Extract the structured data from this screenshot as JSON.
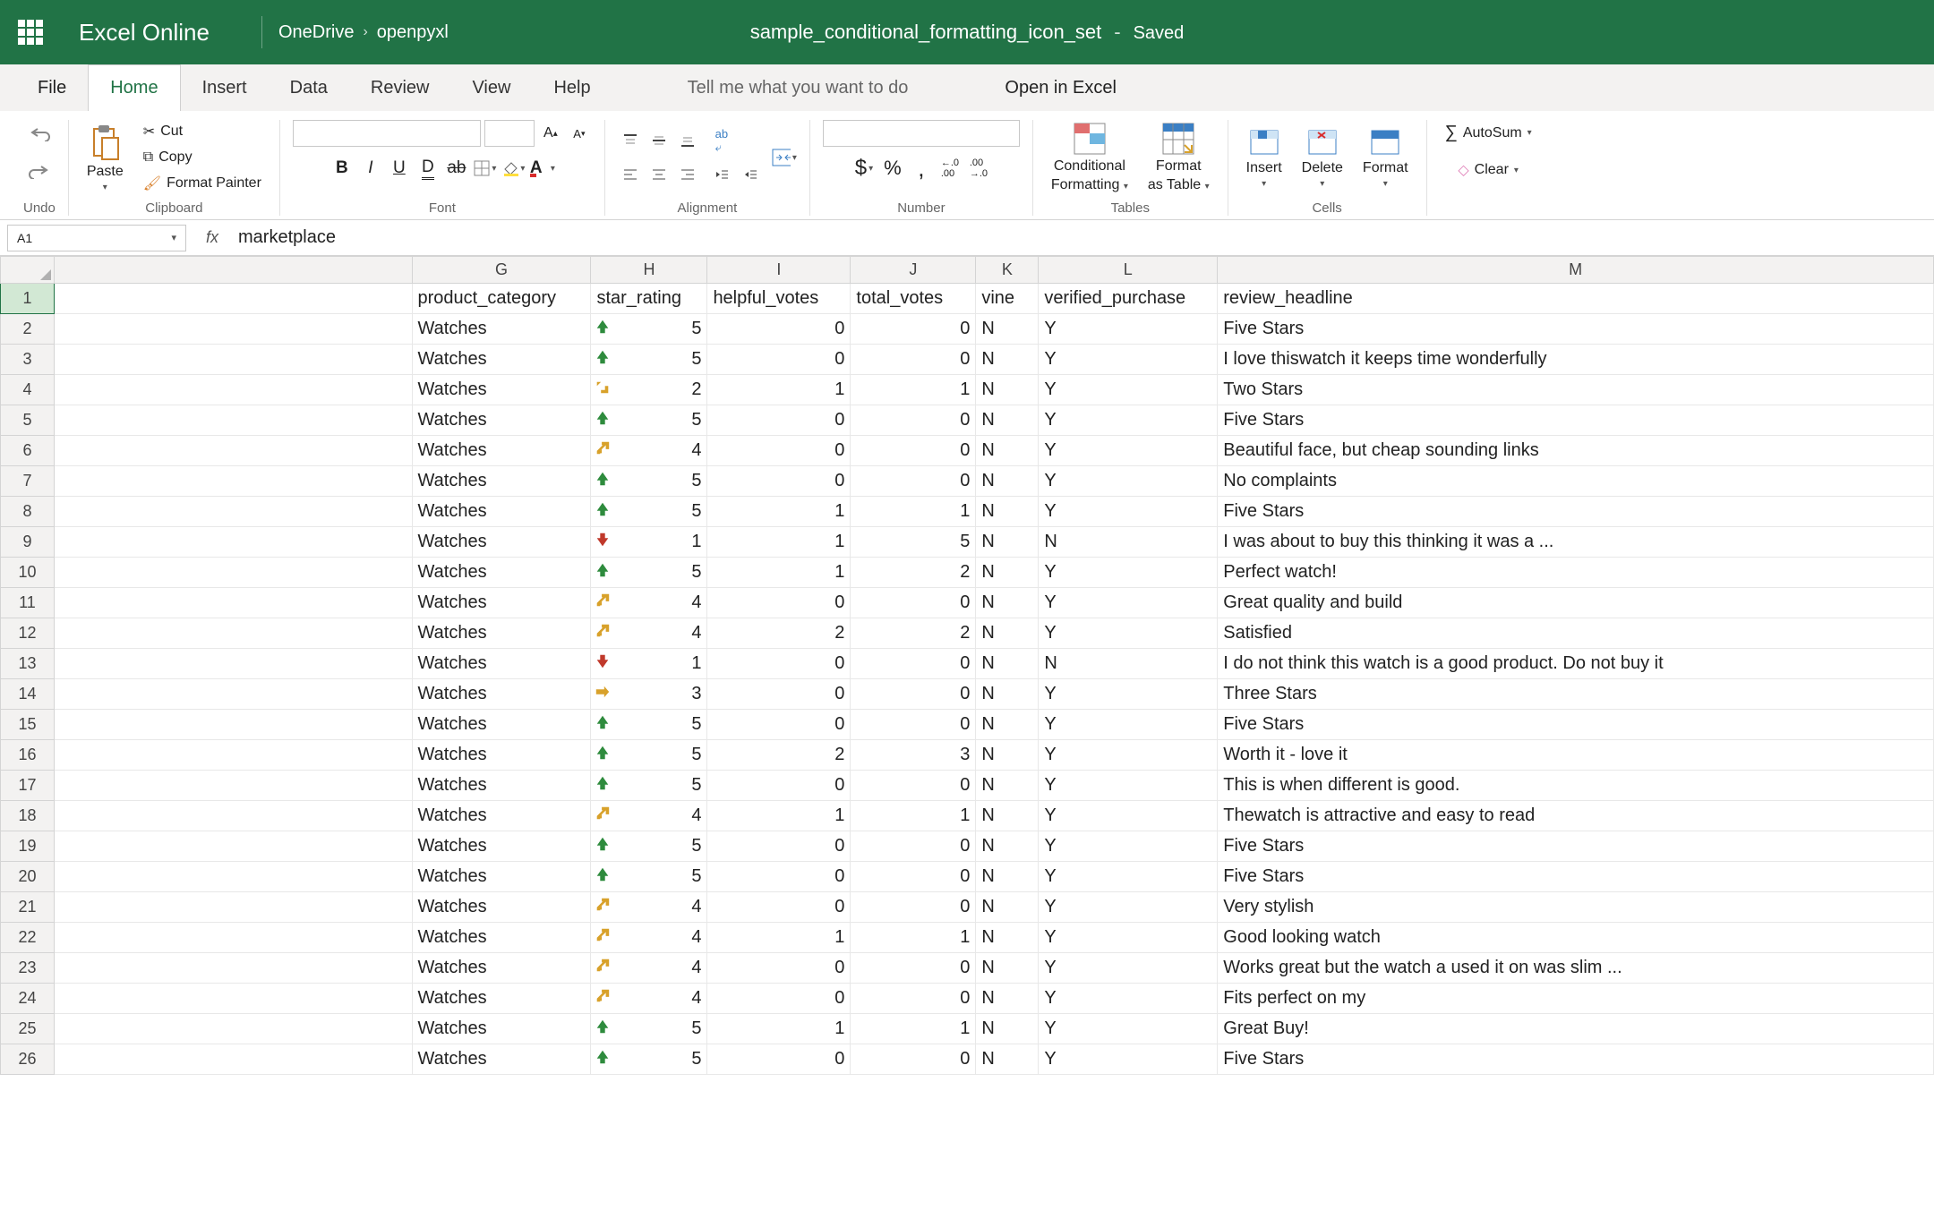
{
  "titlebar": {
    "app_name": "Excel Online",
    "breadcrumb": [
      "OneDrive",
      "openpyxl"
    ],
    "doc_title": "sample_conditional_formatting_icon_set",
    "saved_label": "Saved"
  },
  "ribbon_tabs": {
    "file": "File",
    "home": "Home",
    "insert": "Insert",
    "data": "Data",
    "review": "Review",
    "view": "View",
    "help": "Help",
    "tellme": "Tell me what you want to do",
    "open_in_excel": "Open in Excel"
  },
  "ribbon": {
    "undo_label": "Undo",
    "paste": "Paste",
    "cut": "Cut",
    "copy": "Copy",
    "format_painter": "Format Painter",
    "clipboard_label": "Clipboard",
    "font_label": "Font",
    "alignment_label": "Alignment",
    "number_label": "Number",
    "dollar": "$",
    "percent": "%",
    "comma": ",",
    "dec_inc": ".00",
    "dec_dec": ".00",
    "tables_label": "Tables",
    "cond_fmt": "Conditional",
    "cond_fmt2": "Formatting",
    "fmt_table": "Format",
    "fmt_table2": "as Table",
    "cells_label": "Cells",
    "insert_btn": "Insert",
    "delete_btn": "Delete",
    "format_btn": "Format",
    "autosum": "AutoSum",
    "clear": "Clear"
  },
  "formula_bar": {
    "namebox": "A1",
    "fx": "fx",
    "value": "marketplace"
  },
  "columns": [
    "G",
    "H",
    "I",
    "J",
    "K",
    "L",
    "M"
  ],
  "headers": {
    "G": "product_category",
    "H": "star_rating",
    "I": "helpful_votes",
    "J": "total_votes",
    "K": "vine",
    "L": "verified_purchase",
    "M": "review_headline"
  },
  "rows": [
    {
      "n": 2,
      "G": "Watches",
      "H": 5,
      "icon": "up",
      "I": 0,
      "J": 0,
      "K": "N",
      "L": "Y",
      "M": "Five Stars"
    },
    {
      "n": 3,
      "G": "Watches",
      "H": 5,
      "icon": "up",
      "I": 0,
      "J": 0,
      "K": "N",
      "L": "Y",
      "M": "I love thiswatch it keeps time wonderfully"
    },
    {
      "n": 4,
      "G": "Watches",
      "H": 2,
      "icon": "diag-down",
      "I": 1,
      "J": 1,
      "K": "N",
      "L": "Y",
      "M": "Two Stars"
    },
    {
      "n": 5,
      "G": "Watches",
      "H": 5,
      "icon": "up",
      "I": 0,
      "J": 0,
      "K": "N",
      "L": "Y",
      "M": "Five Stars"
    },
    {
      "n": 6,
      "G": "Watches",
      "H": 4,
      "icon": "diag-up",
      "I": 0,
      "J": 0,
      "K": "N",
      "L": "Y",
      "M": "Beautiful face, but cheap sounding links"
    },
    {
      "n": 7,
      "G": "Watches",
      "H": 5,
      "icon": "up",
      "I": 0,
      "J": 0,
      "K": "N",
      "L": "Y",
      "M": "No complaints"
    },
    {
      "n": 8,
      "G": "Watches",
      "H": 5,
      "icon": "up",
      "I": 1,
      "J": 1,
      "K": "N",
      "L": "Y",
      "M": "Five Stars"
    },
    {
      "n": 9,
      "G": "Watches",
      "H": 1,
      "icon": "down",
      "I": 1,
      "J": 5,
      "K": "N",
      "L": "N",
      "M": "I was about to buy this thinking it was a ..."
    },
    {
      "n": 10,
      "G": "Watches",
      "H": 5,
      "icon": "up",
      "I": 1,
      "J": 2,
      "K": "N",
      "L": "Y",
      "M": "Perfect watch!"
    },
    {
      "n": 11,
      "G": "Watches",
      "H": 4,
      "icon": "diag-up",
      "I": 0,
      "J": 0,
      "K": "N",
      "L": "Y",
      "M": "Great quality and build"
    },
    {
      "n": 12,
      "G": "Watches",
      "H": 4,
      "icon": "diag-up",
      "I": 2,
      "J": 2,
      "K": "N",
      "L": "Y",
      "M": "Satisfied"
    },
    {
      "n": 13,
      "G": "Watches",
      "H": 1,
      "icon": "down",
      "I": 0,
      "J": 0,
      "K": "N",
      "L": "N",
      "M": "I do not think this watch is a good product. Do not buy it"
    },
    {
      "n": 14,
      "G": "Watches",
      "H": 3,
      "icon": "side",
      "I": 0,
      "J": 0,
      "K": "N",
      "L": "Y",
      "M": "Three Stars"
    },
    {
      "n": 15,
      "G": "Watches",
      "H": 5,
      "icon": "up",
      "I": 0,
      "J": 0,
      "K": "N",
      "L": "Y",
      "M": "Five Stars"
    },
    {
      "n": 16,
      "G": "Watches",
      "H": 5,
      "icon": "up",
      "I": 2,
      "J": 3,
      "K": "N",
      "L": "Y",
      "M": "Worth it - love it"
    },
    {
      "n": 17,
      "G": "Watches",
      "H": 5,
      "icon": "up",
      "I": 0,
      "J": 0,
      "K": "N",
      "L": "Y",
      "M": "This is when different is good."
    },
    {
      "n": 18,
      "G": "Watches",
      "H": 4,
      "icon": "diag-up",
      "I": 1,
      "J": 1,
      "K": "N",
      "L": "Y",
      "M": "Thewatch is attractive and easy to read"
    },
    {
      "n": 19,
      "G": "Watches",
      "H": 5,
      "icon": "up",
      "I": 0,
      "J": 0,
      "K": "N",
      "L": "Y",
      "M": "Five Stars"
    },
    {
      "n": 20,
      "G": "Watches",
      "H": 5,
      "icon": "up",
      "I": 0,
      "J": 0,
      "K": "N",
      "L": "Y",
      "M": "Five Stars"
    },
    {
      "n": 21,
      "G": "Watches",
      "H": 4,
      "icon": "diag-up",
      "I": 0,
      "J": 0,
      "K": "N",
      "L": "Y",
      "M": "Very stylish"
    },
    {
      "n": 22,
      "G": "Watches",
      "H": 4,
      "icon": "diag-up",
      "I": 1,
      "J": 1,
      "K": "N",
      "L": "Y",
      "M": "Good looking watch"
    },
    {
      "n": 23,
      "G": "Watches",
      "H": 4,
      "icon": "diag-up",
      "I": 0,
      "J": 0,
      "K": "N",
      "L": "Y",
      "M": "Works great but the watch a used it on was slim ..."
    },
    {
      "n": 24,
      "G": "Watches",
      "H": 4,
      "icon": "diag-up",
      "I": 0,
      "J": 0,
      "K": "N",
      "L": "Y",
      "M": "Fits perfect on my"
    },
    {
      "n": 25,
      "G": "Watches",
      "H": 5,
      "icon": "up",
      "I": 1,
      "J": 1,
      "K": "N",
      "L": "Y",
      "M": "Great Buy!"
    },
    {
      "n": 26,
      "G": "Watches",
      "H": 5,
      "icon": "up",
      "I": 0,
      "J": 0,
      "K": "N",
      "L": "Y",
      "M": "Five Stars"
    }
  ]
}
